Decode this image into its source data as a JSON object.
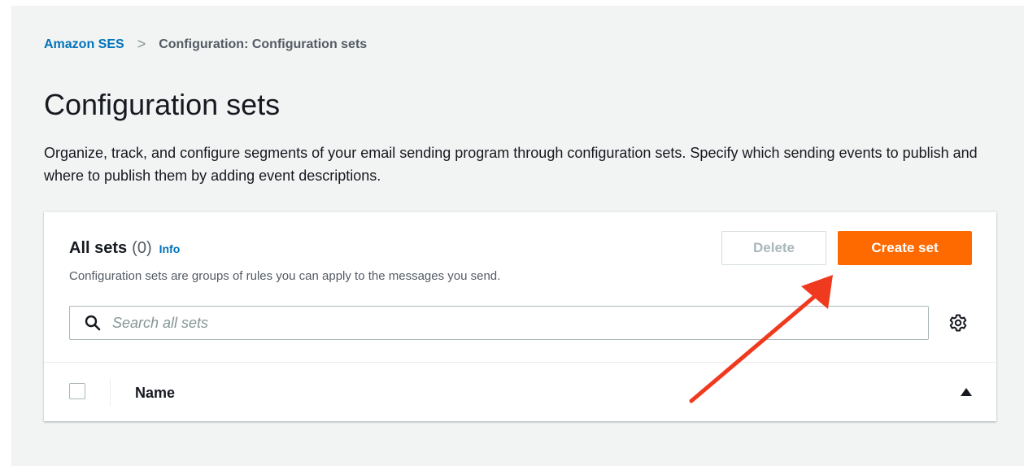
{
  "breadcrumb": {
    "root": "Amazon SES",
    "separator": ">",
    "current": "Configuration: Configuration sets"
  },
  "page": {
    "title": "Configuration sets",
    "description": "Organize, track, and configure segments of your email sending program through configuration sets. Specify which sending events to publish and where to publish them by adding event descriptions."
  },
  "card": {
    "title": "All sets",
    "count": "(0)",
    "info": "Info",
    "subtitle": "Configuration sets are groups of rules you can apply to the messages you send.",
    "delete_label": "Delete",
    "create_label": "Create set",
    "search_placeholder": "Search all sets"
  },
  "table": {
    "columns": [
      "Name"
    ]
  },
  "colors": {
    "accent": "#ff6a00",
    "link": "#0073bb",
    "annotation_arrow": "#f03a1f"
  },
  "icons": {
    "search": "search-icon",
    "settings": "gear-icon",
    "sort": "sort-ascending-icon",
    "annotation": "arrow-annotation"
  }
}
